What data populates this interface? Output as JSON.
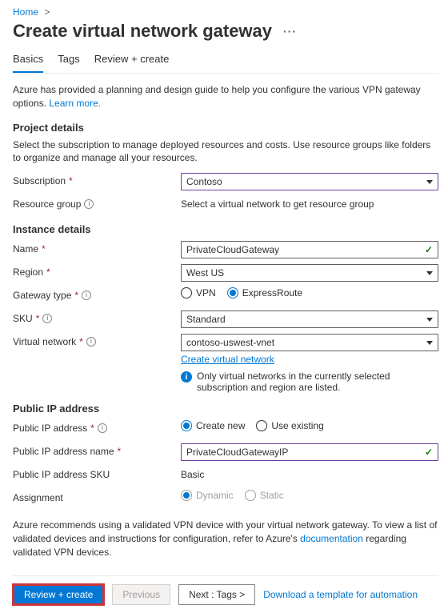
{
  "breadcrumb": {
    "home": "Home"
  },
  "page": {
    "title": "Create virtual network gateway"
  },
  "tabs": {
    "basics": "Basics",
    "tags": "Tags",
    "review": "Review + create"
  },
  "intro": {
    "text": "Azure has provided a planning and design guide to help you configure the various VPN gateway options.  ",
    "link": "Learn more."
  },
  "project": {
    "heading": "Project details",
    "desc": "Select the subscription to manage deployed resources and costs. Use resource groups like folders to organize and manage all your resources.",
    "subscription_label": "Subscription",
    "subscription_value": "Contoso",
    "rg_label": "Resource group",
    "rg_value": "Select a virtual network to get resource group"
  },
  "instance": {
    "heading": "Instance details",
    "name_label": "Name",
    "name_value": "PrivateCloudGateway",
    "region_label": "Region",
    "region_value": "West US",
    "gateway_type_label": "Gateway type",
    "gw_vpn": "VPN",
    "gw_er": "ExpressRoute",
    "sku_label": "SKU",
    "sku_value": "Standard",
    "vnet_label": "Virtual network",
    "vnet_value": "contoso-uswest-vnet",
    "vnet_create_link": "Create virtual network",
    "vnet_note": "Only virtual networks in the currently selected subscription and region are listed."
  },
  "pip": {
    "heading": "Public IP address",
    "pip_label": "Public IP address",
    "pip_create": "Create new",
    "pip_existing": "Use existing",
    "pip_name_label": "Public IP address name",
    "pip_name_value": "PrivateCloudGatewayIP",
    "pip_sku_label": "Public IP address SKU",
    "pip_sku_value": "Basic",
    "assign_label": "Assignment",
    "assign_dynamic": "Dynamic",
    "assign_static": "Static"
  },
  "footer_note": {
    "pre": "Azure recommends using a validated VPN device with your virtual network gateway. To view a list of validated devices and instructions for configuration, refer to Azure's ",
    "link": "documentation",
    "post": " regarding validated VPN devices."
  },
  "footer": {
    "review": "Review + create",
    "previous": "Previous",
    "next": "Next : Tags >",
    "download": "Download a template for automation"
  }
}
